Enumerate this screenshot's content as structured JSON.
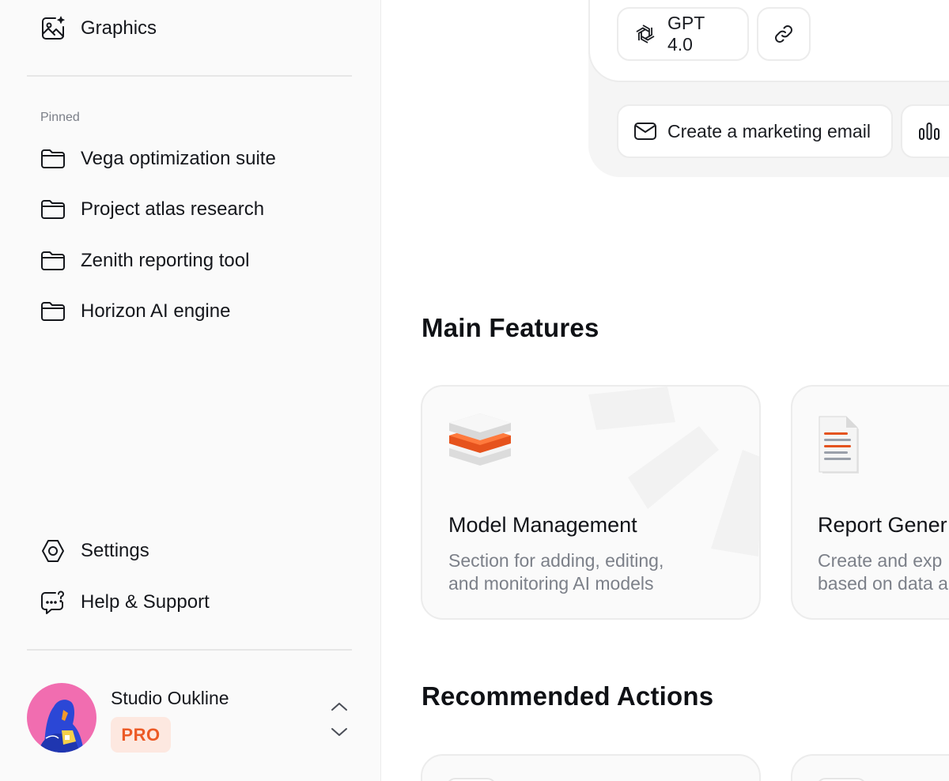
{
  "sidebar": {
    "top_item": {
      "label": "Graphics",
      "icon": "image-sparkle-icon"
    },
    "pinned_label": "Pinned",
    "pinned": [
      {
        "label": "Vega optimization suite",
        "icon": "folder-icon"
      },
      {
        "label": "Project atlas research",
        "icon": "folder-icon"
      },
      {
        "label": "Zenith reporting tool",
        "icon": "folder-icon"
      },
      {
        "label": "Horizon AI engine",
        "icon": "folder-icon"
      }
    ],
    "bottom": [
      {
        "label": "Settings",
        "icon": "settings-icon"
      },
      {
        "label": "Help & Support",
        "icon": "help-chat-icon"
      }
    ],
    "profile": {
      "name": "Studio Oukline",
      "badge": "PRO"
    }
  },
  "composer": {
    "model_label": "GPT 4.0",
    "suggestions": [
      {
        "label": "Create a marketing email",
        "icon": "mail-icon"
      },
      {
        "label": "",
        "icon": "bar-chart-icon"
      }
    ]
  },
  "main": {
    "features_title": "Main Features",
    "features": [
      {
        "title": "Model Management",
        "desc_line1": "Section for adding, editing,",
        "desc_line2": "and monitoring AI models"
      },
      {
        "title": "Report Gener",
        "desc_line1": "Create and exp",
        "desc_line2": "based on data a"
      }
    ],
    "actions_title": "Recommended Actions"
  },
  "colors": {
    "accent": "#ec5a26",
    "badge_bg": "#fde8e0",
    "avatar_bg": "#f16db0"
  }
}
